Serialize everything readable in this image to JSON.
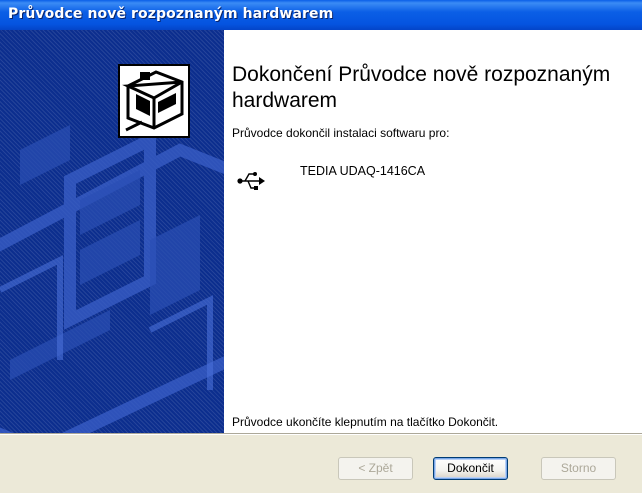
{
  "window": {
    "title": "Průvodce nově rozpoznaným hardwarem"
  },
  "sidebar": {
    "icon": "hardware-wizard-icon",
    "bg_color": "#0c2e8e",
    "pattern_color": "#3a5fc8"
  },
  "content": {
    "heading": "Dokončení Průvodce nově rozpoznaným hardwarem",
    "subtext": "Průvodce dokončil instalaci softwaru pro:",
    "device_icon": "usb-icon",
    "device_name": "TEDIA UDAQ-1416CA",
    "finish_text": "Průvodce ukončíte klepnutím na tlačítko Dokončit."
  },
  "buttons": {
    "back_label": "< Zpět",
    "finish_label": "Dokončit",
    "cancel_label": "Storno"
  },
  "colors": {
    "titlebar": "#0554e0",
    "button_border": "#003c74",
    "disabled_text": "#aca899"
  }
}
